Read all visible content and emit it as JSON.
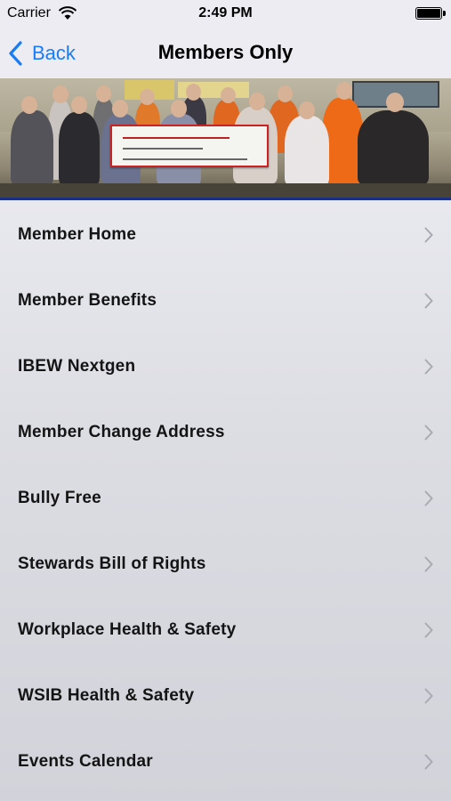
{
  "status_bar": {
    "carrier": "Carrier",
    "time": "2:49 PM",
    "icons": [
      "wifi-icon",
      "battery-icon"
    ]
  },
  "nav": {
    "back_label": "Back",
    "title": "Members Only",
    "accent_color": "#1a7cf5"
  },
  "hero": {
    "image": "group-photo-cheque-presentation"
  },
  "menu": {
    "items": [
      {
        "label": "Member Home"
      },
      {
        "label": "Member Benefits"
      },
      {
        "label": "IBEW Nextgen"
      },
      {
        "label": "Member Change Address"
      },
      {
        "label": "Bully Free"
      },
      {
        "label": "Stewards Bill of Rights"
      },
      {
        "label": "Workplace Health & Safety"
      },
      {
        "label": "WSIB Health & Safety"
      },
      {
        "label": "Events Calendar"
      }
    ]
  }
}
